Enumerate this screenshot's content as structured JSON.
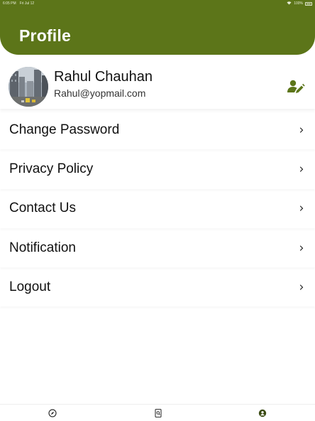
{
  "status_bar": {
    "time": "6:05 PM",
    "date": "Fri Jul 12",
    "battery": "100%"
  },
  "header": {
    "title": "Profile"
  },
  "profile": {
    "name": "Rahul Chauhan",
    "email": "Rahul@yopmail.com"
  },
  "menu": {
    "items": [
      {
        "label": "Change Password"
      },
      {
        "label": "Privacy Policy"
      },
      {
        "label": "Contact Us"
      },
      {
        "label": "Notification"
      },
      {
        "label": "Logout"
      }
    ]
  },
  "tabs": [
    {
      "icon": "compass-icon",
      "active": false
    },
    {
      "icon": "search-document-icon",
      "active": false
    },
    {
      "icon": "profile-icon",
      "active": true
    }
  ],
  "colors": {
    "accent": "#5c7519",
    "text": "#111111"
  }
}
